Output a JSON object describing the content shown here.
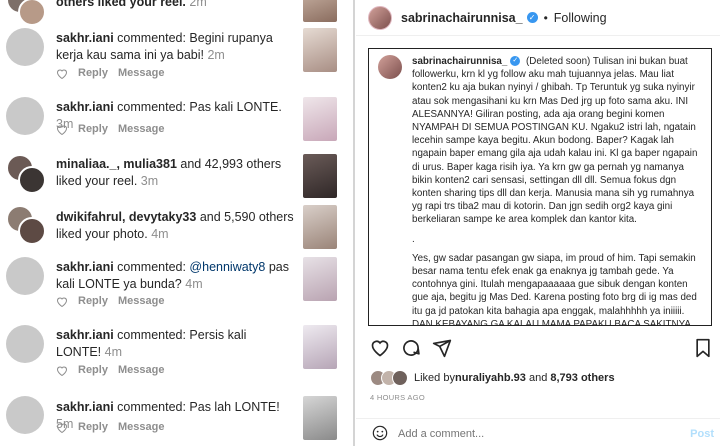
{
  "notifications": [
    {
      "text_pre": "",
      "user": "",
      "text_post": "others liked your reel.",
      "time": "2m"
    },
    {
      "user": "sakhr.iani",
      "text": " commented: Begini rupanya kerja kau sama ini ya babi!",
      "time": "2m",
      "reply": "Reply",
      "message": "Message"
    },
    {
      "user": "sakhr.iani",
      "text": " commented: Pas kali LONTE.",
      "time": "3m",
      "reply": "Reply",
      "message": "Message"
    },
    {
      "users": "minaliaa._, mulia381",
      "text": " and 42,993 others liked your reel.",
      "time": "3m"
    },
    {
      "users": "dwikifahrul, devytaky33",
      "text": " and 5,590 others liked your photo.",
      "time": "4m"
    },
    {
      "user": "sakhr.iani",
      "text_a": " commented: ",
      "mention": "@henniwaty8",
      "text_b": " pas kali LONTE ya bunda?",
      "time": "4m",
      "reply": "Reply",
      "message": "Message"
    },
    {
      "user": "sakhr.iani",
      "text": " commented: Persis kali LONTE!",
      "time": "4m",
      "reply": "Reply",
      "message": "Message"
    },
    {
      "user": "sakhr.iani",
      "text": " commented: Pas lah LONTE!",
      "time": "5m",
      "reply": "Reply",
      "message": "Message"
    }
  ],
  "post": {
    "username": "sabrinachairunnisa_",
    "dot": "•",
    "follow_state": "Following",
    "caption_user": "sabrinachairunnisa_",
    "caption_p1": "(Deleted soon) Tulisan ini bukan buat followerku, krn kl yg follow aku mah tujuannya jelas. Mau liat konten2 ku aja bukan nyinyi / ghibah. Tp Teruntuk yg suka nyinyir atau sok mengasihani ku krn Mas Ded jrg up foto sama aku. INI ALESANNYA! Giliran posting, ada aja orang begini komen NYAMPAH DI SEMUA POSTINGAN KU. Ngaku2 istri lah, ngatain lecehin sampe kaya begitu. Akun bodong. Baper? Kagak lah ngapain baper emang gila aja udah kalau ini. Kl ga baper ngapain di urus. Baper kaga risih iya. Ya krn gw ga pernah yg namanya bikin konten2 cari sensasi, settingan dll dll. Semua fokus dgn konten sharing tips dll dan kerja. Manusia mana sih yg rumahnya yg rapi trs tiba2 mau di kotorin. Dan jgn sedih org2 kaya gini berkeliaran sampe ke area komplek dan kantor kita.",
    "caption_p2": ".",
    "caption_p3": "Yes, gw sadar pasangan gw siapa, im proud of him. Tapi semakin besar nama tentu efek enak ga enaknya jg tambah gede. Ya contohnya gini. Itulah mengapaaaaaa gue sibuk dengan konten gue aja, begitu jg Mas Ded. Karena posting foto brg di ig mas ded itu ga jd patokan kita bahagia apa enggak, malahhhhh ya iniiiii. DAN KEBAYANG GA KALAU MAMA PAPAKU BACA SAKITNYA KAYA",
    "likes_prefix": "Liked by ",
    "likes_user": "nuraliyahb.93",
    "likes_mid": " and ",
    "likes_count": "8,793 others",
    "time_ago": "4 HOURS AGO",
    "comment_placeholder": "Add a comment...",
    "post_button": "Post"
  },
  "colors": {
    "link_blue": "#00376b",
    "verified_blue": "#3897f0",
    "post_btn_disabled": "#b2dffc",
    "muted": "#8e8e8e"
  }
}
